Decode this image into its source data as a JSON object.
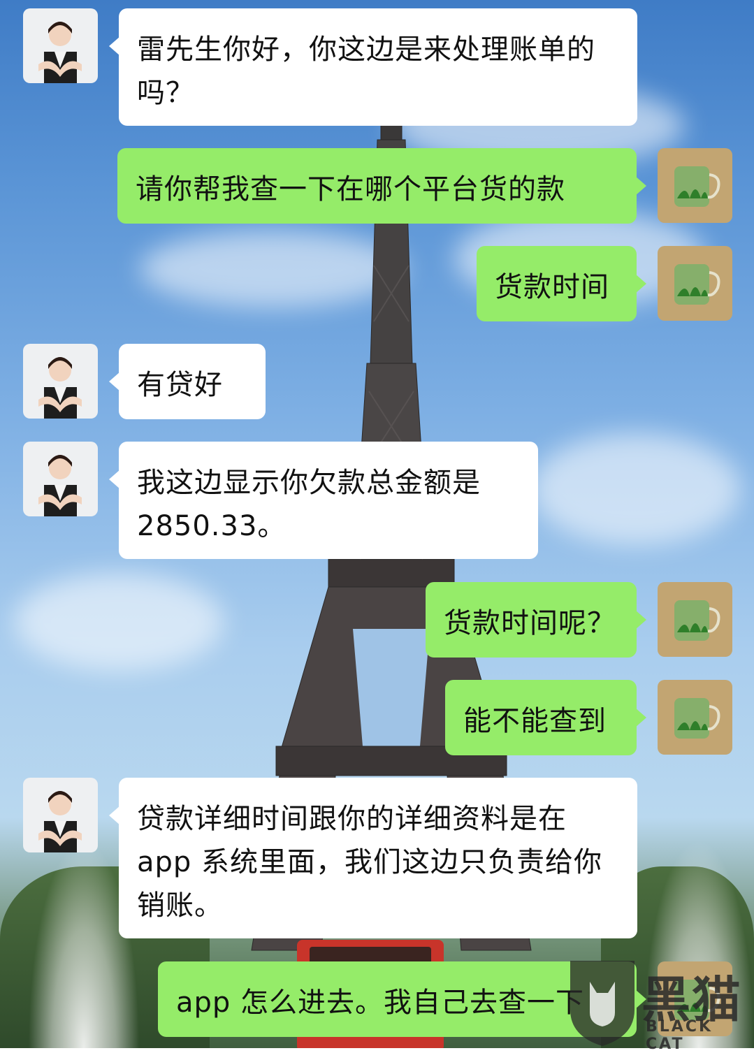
{
  "messages": [
    {
      "side": "recv",
      "text": "雷先生你好，你这边是来处理账单的吗？"
    },
    {
      "side": "sent",
      "text": "请你帮我查一下在哪个平台货的款"
    },
    {
      "side": "sent",
      "text": "货款时间"
    },
    {
      "side": "recv",
      "text": "有贷好"
    },
    {
      "side": "recv",
      "text": "我这边显示你欠款总金额是2850.33。"
    },
    {
      "side": "sent",
      "text": "货款时间呢？"
    },
    {
      "side": "sent",
      "text": "能不能查到"
    },
    {
      "side": "recv",
      "text": "贷款详细时间跟你的详细资料是在app 系统里面，我们这边只负责给你销账。"
    },
    {
      "side": "sent",
      "text": "app 怎么进去。我自己去查一下"
    }
  ],
  "watermark": {
    "logo_text": "黑猫",
    "sub_text": "BLACK CAT"
  },
  "colors": {
    "sent_bubble": "#95ec69",
    "recv_bubble": "#ffffff"
  },
  "icons": {
    "agent_avatar": "customer-service-agent-avatar",
    "user_avatar": "green-tea-cup-avatar"
  }
}
